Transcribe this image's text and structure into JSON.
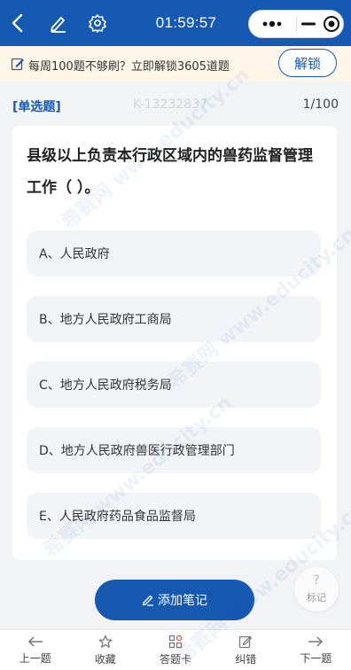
{
  "top_bar": {
    "time": "01:59:57",
    "icons": [
      "back-arrow-icon",
      "edit-pen-icon",
      "gear-icon"
    ],
    "capsule_icons": [
      "more-dots-icon",
      "minimize-icon",
      "close-target-icon"
    ],
    "background": "#1559b3"
  },
  "promo": {
    "text": "每周100题不够刷？立即解锁3605道题",
    "unlock_label": "解锁",
    "icon": "edit-note-icon"
  },
  "question": {
    "type_label": "[单选题]",
    "id_text": "K-13232837",
    "progress": "1/100",
    "stem": "县级以上负责本行政区域内的兽药监督管理工作（  ）。",
    "options": [
      "A、人民政府",
      "B、地方人民政府工商局",
      "C、地方人民政府税务局",
      "D、地方人民政府兽医行政管理部门",
      "E、人民政府药品食品监督局"
    ]
  },
  "side_mark": {
    "symbol": "?",
    "label": "标记"
  },
  "note_button": {
    "label": "添加笔记",
    "icon": "pen-icon"
  },
  "bottom_nav": {
    "items": [
      {
        "label": "上一题",
        "icon": "arrow-left-icon"
      },
      {
        "label": "收藏",
        "icon": "star-icon"
      },
      {
        "label": "答题卡",
        "icon": "grid-card-icon"
      },
      {
        "label": "纠错",
        "icon": "edit-box-icon"
      },
      {
        "label": "下一题",
        "icon": "arrow-right-icon"
      }
    ]
  },
  "watermark": "希赛网 www.educity.cn",
  "colors": {
    "accent": "#1559b3",
    "promo_bg": "#fff6ea",
    "page_bg": "#f2f3f5",
    "option_bg": "#f3f4f7"
  }
}
